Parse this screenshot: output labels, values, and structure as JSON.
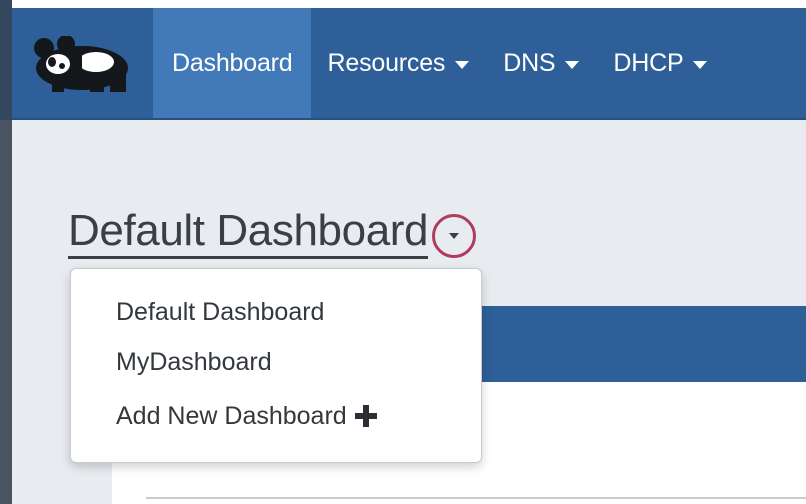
{
  "navbar": {
    "brand_icon": "panda-logo-icon",
    "items": [
      {
        "label": "Dashboard",
        "has_caret": false,
        "active": true
      },
      {
        "label": "Resources",
        "has_caret": true,
        "active": false
      },
      {
        "label": "DNS",
        "has_caret": true,
        "active": false
      },
      {
        "label": "DHCP",
        "has_caret": true,
        "active": false
      }
    ]
  },
  "page": {
    "title": "Default Dashboard",
    "toggle_icon": "chevron-down-icon"
  },
  "dashboard_menu": {
    "items": [
      {
        "label": "Default Dashboard"
      },
      {
        "label": "MyDashboard"
      },
      {
        "label": "Add New Dashboard",
        "icon": "plus-icon"
      }
    ]
  },
  "colors": {
    "navbar": "#2f5f99",
    "navbar_active": "#4279b8",
    "toggle_ring": "#b13b5e",
    "background": "#e8ebef"
  }
}
